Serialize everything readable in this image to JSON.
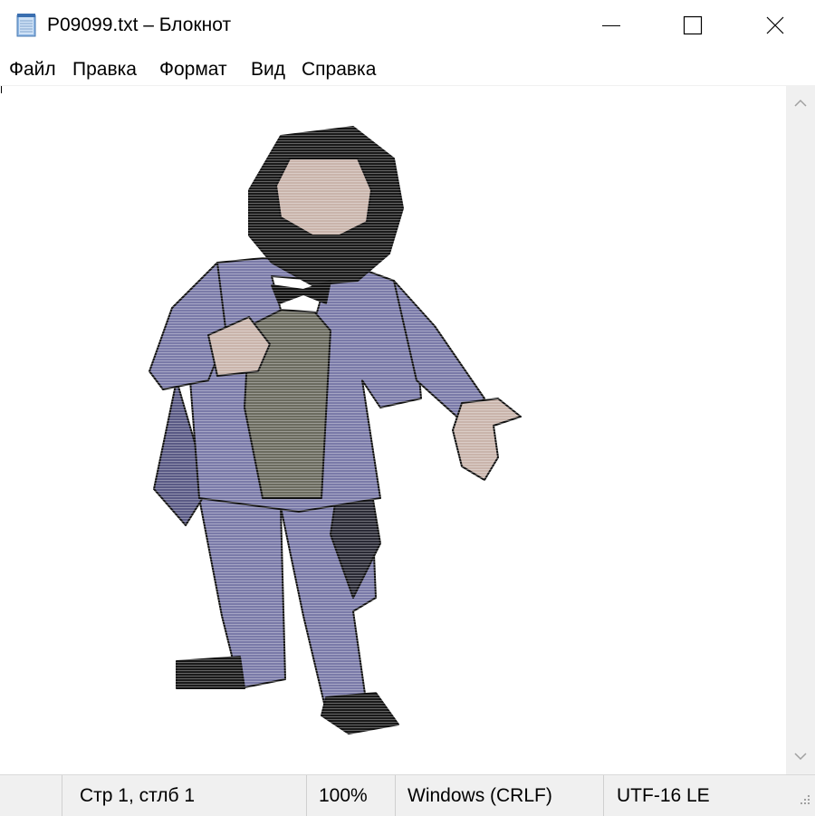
{
  "window": {
    "title": "P09099.txt – Блокнот",
    "icon": "notepad-icon"
  },
  "controls": {
    "minimize": "minimize-icon",
    "maximize": "maximize-icon",
    "close": "close-icon"
  },
  "menu": {
    "items": [
      {
        "label": "Файл"
      },
      {
        "label": "Правка"
      },
      {
        "label": "Формат"
      },
      {
        "label": "Вид"
      },
      {
        "label": "Справка"
      }
    ]
  },
  "editor": {
    "content": "ascii-art-portrait-bearded-man-in-suit"
  },
  "statusbar": {
    "position": "Стр 1, стлб 1",
    "zoom": "100%",
    "line_ending": "Windows (CRLF)",
    "encoding": "UTF-16 LE"
  },
  "colors": {
    "suit": "#7a7aa8",
    "suit_shade": "#5a5a85",
    "vest": "#6b6b5f",
    "skin": "#c9b4ab",
    "hair": "#1a1a1a",
    "statusbar_bg": "#f0f0f0"
  }
}
